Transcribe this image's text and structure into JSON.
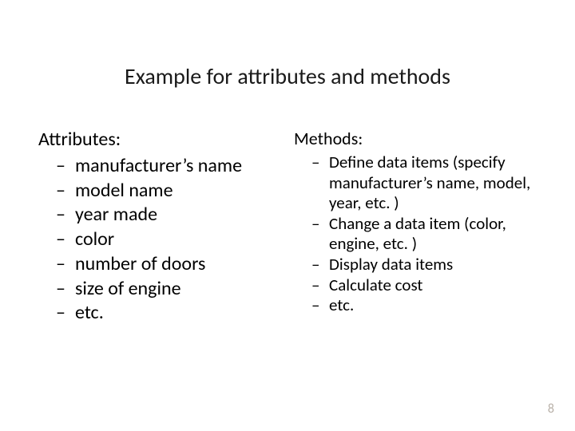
{
  "title": "Example for attributes and methods",
  "left": {
    "heading": "Attributes:",
    "items": [
      "manufacturer’s name",
      "model name",
      "year made",
      "color",
      "number of doors",
      "size of engine",
      "etc."
    ]
  },
  "right": {
    "heading": "Methods:",
    "items": [
      "Define data items (specify manufacturer’s name, model, year, etc. )",
      "Change a data item (color, engine, etc. )",
      "Display data items",
      "Calculate cost",
      "etc."
    ]
  },
  "page_number": "8"
}
